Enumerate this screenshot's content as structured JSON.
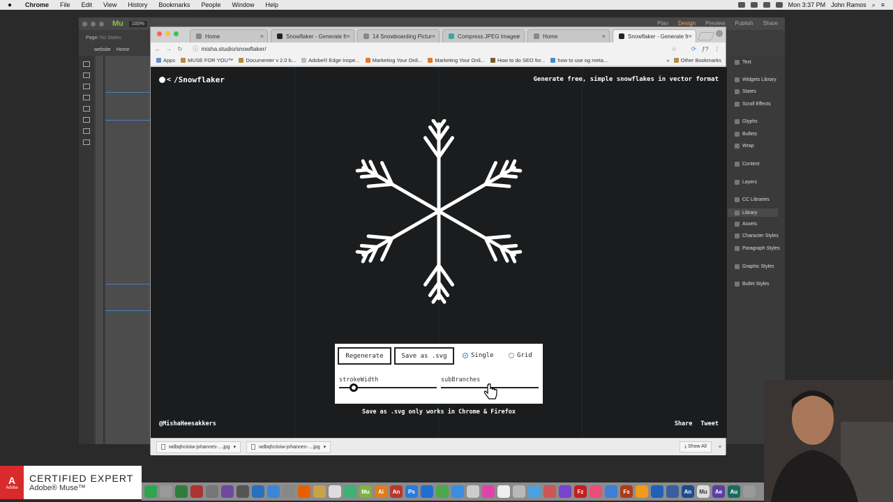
{
  "menubar": {
    "app": "Chrome",
    "items": [
      "File",
      "Edit",
      "View",
      "History",
      "Bookmarks",
      "People",
      "Window",
      "Help"
    ],
    "clock": "Mon 3:37 PM",
    "user": "John Ramos"
  },
  "muse": {
    "logo": "Mu",
    "zoom": "100%",
    "page_label": "Page:",
    "page_value": "No States",
    "tabs": [
      "website",
      "Home"
    ],
    "modes": [
      "Plan",
      "Design",
      "Preview",
      "Publish",
      "Share"
    ],
    "panel_items": [
      "Text",
      "Widgets Library",
      "States",
      "Scroll Effects",
      "Glyphs",
      "Bullets",
      "Wrap",
      "Content",
      "Layers",
      "CC Libraries",
      "Library",
      "Assets",
      "Character Styles",
      "Paragraph Styles",
      "Graphic Styles",
      "Bullet Styles"
    ],
    "panel_active": "Library"
  },
  "chrome": {
    "tabs": [
      {
        "label": "Home"
      },
      {
        "label": "Snowflaker - Generate fr"
      },
      {
        "label": "14 Snowboarding Pictur"
      },
      {
        "label": "Compress JPEG Images"
      },
      {
        "label": "Home"
      },
      {
        "label": "Snowflaker - Generate fr"
      }
    ],
    "url": "misha.studio/snowflaker/",
    "bookmarks": [
      "Apps",
      "MUSE FOR YOU™",
      "Documenter v 2.0 b...",
      "Adobe® Edge Inspe...",
      "Marketing Your Onli...",
      "Marketing Your Onli...",
      "How to do SEO for...",
      "how to use og meta..."
    ],
    "bookmarks_more": "»",
    "other_bookmarks": "Other Bookmarks",
    "downloads": [
      "wdbqhciisiw-johannes-....jpg",
      "wdbqhciisiw-johannes-....jpg"
    ],
    "show_all": "Show All"
  },
  "page": {
    "brand": "/Snowflaker",
    "tagline": "Generate free, simple snowflakes in vector format",
    "regenerate": "Regenerate",
    "save_svg": "Save as .svg",
    "radio_single": "Single",
    "radio_grid": "Grid",
    "radio_selected": "Single",
    "slider_stroke_label": "strokeWidth",
    "slider_stroke_value": 0.15,
    "slider_branches_label": "subBranches",
    "slider_branches_value": 0.45,
    "note": "Save as .svg only works in Chrome & Firefox",
    "author": "@MishaHeesakkers",
    "share": "Share",
    "tweet": "Tweet",
    "accent": "#3f86d6"
  },
  "badge": {
    "line1": "CERTIFIED EXPERT",
    "line2": "Adobe® Muse™",
    "adobe": "Adobe"
  }
}
